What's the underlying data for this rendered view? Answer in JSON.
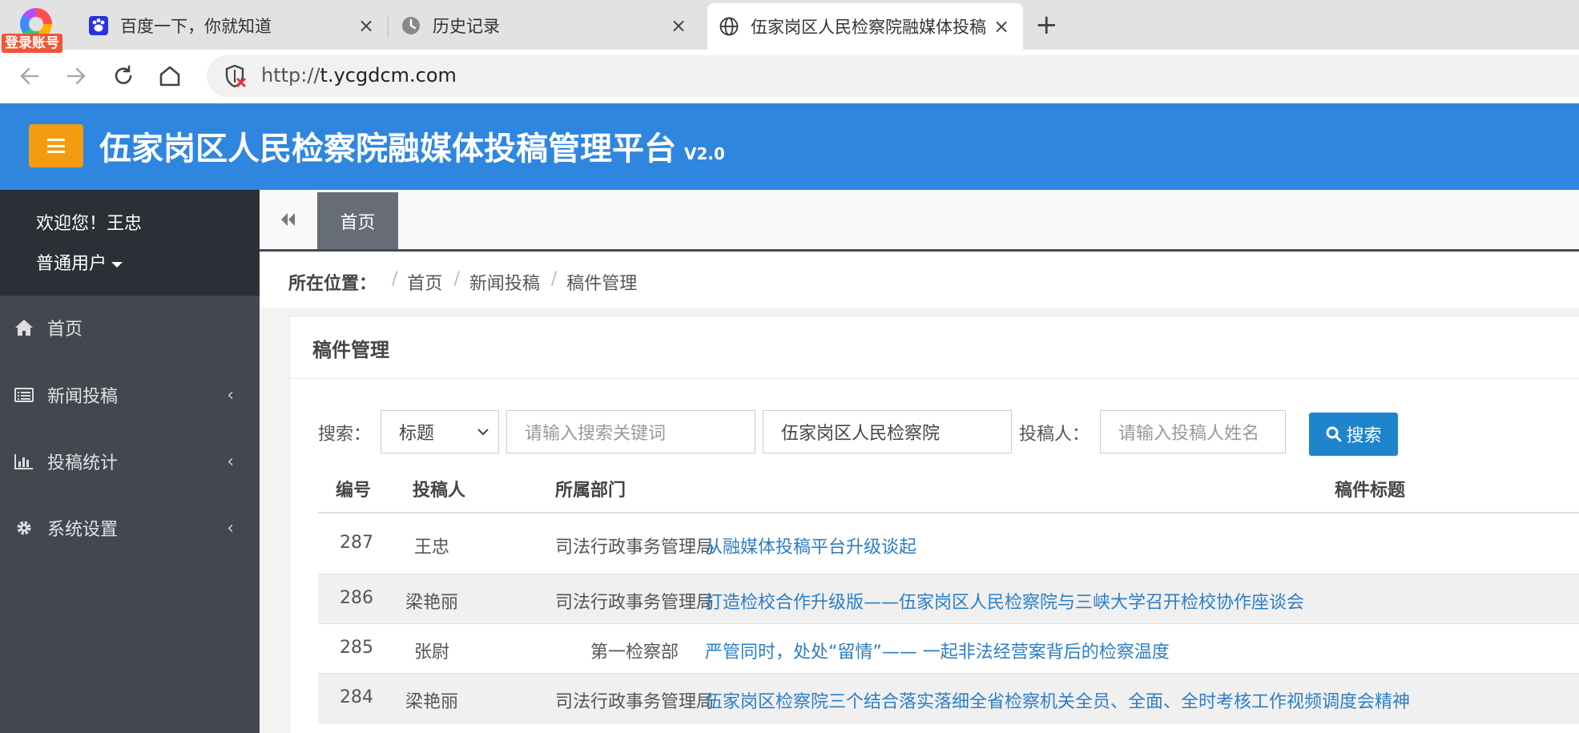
{
  "browser": {
    "login_badge": "登录账号",
    "tabs": [
      {
        "title": "百度一下，你就知道",
        "icon": "baidu-paw-icon"
      },
      {
        "title": "历史记录",
        "icon": "clock-icon"
      },
      {
        "title": "伍家岗区人民检察院融媒体投稿",
        "icon": "globe-icon"
      }
    ],
    "close_glyph": "×",
    "new_tab_glyph": "+",
    "url_scheme": "http://",
    "url_host": "t.ycgdcm.com"
  },
  "header": {
    "title": "伍家岗区人民检察院融媒体投稿管理平台",
    "version": "V2.0"
  },
  "sidebar": {
    "welcome": "欢迎您！王忠",
    "role": "普通用户",
    "items": [
      {
        "label": "首页",
        "icon": "home-icon"
      },
      {
        "label": "新闻投稿",
        "icon": "list-icon"
      },
      {
        "label": "投稿统计",
        "icon": "bar-chart-icon"
      },
      {
        "label": "系统设置",
        "icon": "gear-icon"
      }
    ],
    "chevron": "‹"
  },
  "content_tabs": {
    "active": "首页"
  },
  "breadcrumb": {
    "label": "所在位置：",
    "items": [
      "首页",
      "新闻投稿",
      "稿件管理"
    ],
    "separator": "/"
  },
  "panel": {
    "title": "稿件管理"
  },
  "search": {
    "label": "搜索：",
    "field_select": "标题",
    "keyword_placeholder": "请输入搜索关键词",
    "department_value": "伍家岗区人民检察院",
    "submitter_label": "投稿人：",
    "submitter_placeholder": "请输入投稿人姓名",
    "button_label": "搜索"
  },
  "table": {
    "headers": [
      "编号",
      "投稿人",
      "所属部门",
      "稿件标题"
    ],
    "rows": [
      {
        "id": "287",
        "author": "王忠",
        "dept": "司法行政事务管理局",
        "title": "从融媒体投稿平台升级谈起"
      },
      {
        "id": "286",
        "author": "梁艳丽",
        "dept": "司法行政事务管理局",
        "title": "打造检校合作升级版——伍家岗区人民检察院与三峡大学召开检校协作座谈会"
      },
      {
        "id": "285",
        "author": "张尉",
        "dept": "第一检察部",
        "title": "严管同时，处处“留情”—— 一起非法经营案背后的检察温度"
      },
      {
        "id": "284",
        "author": "梁艳丽",
        "dept": "司法行政事务管理局",
        "title": "伍家岗区检察院三个结合落实落细全省检察机关全员、全面、全时考核工作视频调度会精神"
      }
    ]
  }
}
